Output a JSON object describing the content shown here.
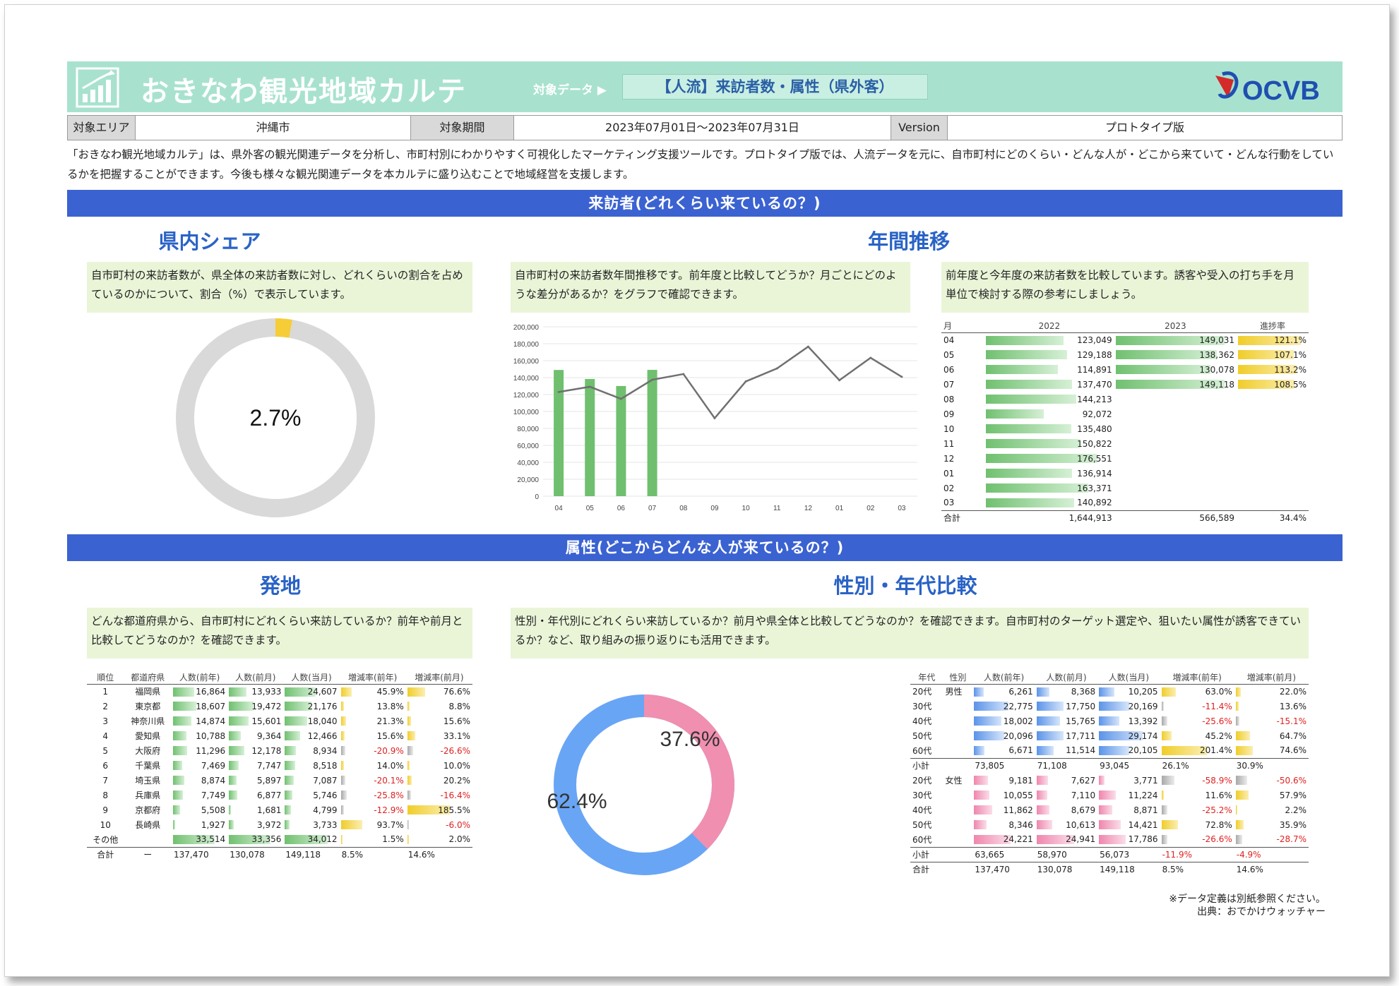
{
  "header": {
    "title": "おきなわ観光地域カルテ",
    "target_label": "対象データ ▶",
    "target_value": "【人流】来訪者数・属性（県外客）",
    "brand": "OCVB"
  },
  "info": {
    "area_label": "対象エリア",
    "area_value": "沖縄市",
    "period_label": "対象期間",
    "period_value": "2023年07月01日～2023年07月31日",
    "version_label": "Version",
    "version_value": "プロトタイプ版"
  },
  "intro": "「おきなわ観光地域カルテ」は、県外客の観光関連データを分析し、市町村別にわかりやすく可視化したマーケティング支援ツールです。プロトタイプ版では、人流データを元に、自市町村にどのくらい・どんな人が・どこから来ていて・どんな行動をしているかを把握することができます。今後も様々な観光関連データを本カルテに盛り込むことで地域経営を支援します。",
  "band1": "来訪者(どれくらい来ているの？)",
  "share": {
    "title": "県内シェア",
    "note": "自市町村の来訪者数が、県全体の来訪者数に対し、どれくらいの割合を占めているのかについて、割合（%）で表示しています。",
    "value_label": "2.7%",
    "value": 2.7,
    "colors": {
      "fill": "#f7cd37",
      "rest": "#d9d9d9"
    }
  },
  "annual": {
    "title": "年間推移",
    "note": "自市町村の来訪者数年間推移です。前年度と比較してどうか？月ごとにどのような差分があるか？をグラフで確認できます。",
    "note2": "前年度と今年度の来訪者数を比較しています。誘客や受入の打ち手を月単位で検討する際の参考にしましょう。"
  },
  "chart_data": {
    "type": "bar",
    "categories": [
      "04",
      "05",
      "06",
      "07",
      "08",
      "09",
      "10",
      "11",
      "12",
      "01",
      "02",
      "03"
    ],
    "series": [
      {
        "type": "bar",
        "values": [
          149031,
          138362,
          130078,
          149118,
          null,
          null,
          null,
          null,
          null,
          null,
          null,
          null
        ],
        "color": "#6fbf6f"
      },
      {
        "type": "line",
        "values": [
          123049,
          129188,
          114891,
          137470,
          144213,
          92072,
          135480,
          150822,
          176551,
          136914,
          163371,
          140892
        ],
        "color": "#707070"
      }
    ],
    "ylim": [
      0,
      200000
    ],
    "yticks": [
      "200,000",
      "180,000",
      "160,000",
      "140,000",
      "120,000",
      "100,000",
      "80,000",
      "60,000",
      "40,000",
      "20,000",
      "0"
    ]
  },
  "monthly_table": {
    "headers": [
      "月",
      "2022",
      "2023",
      "進捗率"
    ],
    "rows": [
      {
        "m": "04",
        "a": "123,049",
        "b": "149,031",
        "r": "121.1%"
      },
      {
        "m": "05",
        "a": "129,188",
        "b": "138,362",
        "r": "107.1%"
      },
      {
        "m": "06",
        "a": "114,891",
        "b": "130,078",
        "r": "113.2%"
      },
      {
        "m": "07",
        "a": "137,470",
        "b": "149,118",
        "r": "108.5%"
      },
      {
        "m": "08",
        "a": "144,213",
        "b": "",
        "r": ""
      },
      {
        "m": "09",
        "a": "92,072",
        "b": "",
        "r": ""
      },
      {
        "m": "10",
        "a": "135,480",
        "b": "",
        "r": ""
      },
      {
        "m": "11",
        "a": "150,822",
        "b": "",
        "r": ""
      },
      {
        "m": "12",
        "a": "176,551",
        "b": "",
        "r": ""
      },
      {
        "m": "01",
        "a": "136,914",
        "b": "",
        "r": ""
      },
      {
        "m": "02",
        "a": "163,371",
        "b": "",
        "r": ""
      },
      {
        "m": "03",
        "a": "140,892",
        "b": "",
        "r": ""
      }
    ],
    "total": {
      "m": "合計",
      "a": "1,644,913",
      "b": "566,589",
      "r": "34.4%"
    }
  },
  "band2": "属性(どこからどんな人が来ているの？)",
  "origin": {
    "title": "発地",
    "note": "どんな都道府県から、自市町村にどれくらい来訪しているか？前年や前月と比較してどうなのか？を確認できます。",
    "headers": [
      "順位",
      "都道府県",
      "人数(前年)",
      "人数(前月)",
      "人数(当月)",
      "増減率(前年)",
      "増減率(前月)"
    ],
    "rows": [
      {
        "rank": "1",
        "pref": "福岡県",
        "p1": "16,864",
        "p2": "13,933",
        "p3": "24,607",
        "r1": "45.9%",
        "r2": "76.6%"
      },
      {
        "rank": "2",
        "pref": "東京都",
        "p1": "18,607",
        "p2": "19,472",
        "p3": "21,176",
        "r1": "13.8%",
        "r2": "8.8%"
      },
      {
        "rank": "3",
        "pref": "神奈川県",
        "p1": "14,874",
        "p2": "15,601",
        "p3": "18,040",
        "r1": "21.3%",
        "r2": "15.6%"
      },
      {
        "rank": "4",
        "pref": "愛知県",
        "p1": "10,788",
        "p2": "9,364",
        "p3": "12,466",
        "r1": "15.6%",
        "r2": "33.1%"
      },
      {
        "rank": "5",
        "pref": "大阪府",
        "p1": "11,296",
        "p2": "12,178",
        "p3": "8,934",
        "r1": "-20.9%",
        "r2": "-26.6%"
      },
      {
        "rank": "6",
        "pref": "千葉県",
        "p1": "7,469",
        "p2": "7,747",
        "p3": "8,518",
        "r1": "14.0%",
        "r2": "10.0%"
      },
      {
        "rank": "7",
        "pref": "埼玉県",
        "p1": "8,874",
        "p2": "5,897",
        "p3": "7,087",
        "r1": "-20.1%",
        "r2": "20.2%"
      },
      {
        "rank": "8",
        "pref": "兵庫県",
        "p1": "7,749",
        "p2": "6,877",
        "p3": "5,746",
        "r1": "-25.8%",
        "r2": "-16.4%"
      },
      {
        "rank": "9",
        "pref": "京都府",
        "p1": "5,508",
        "p2": "1,681",
        "p3": "4,799",
        "r1": "-12.9%",
        "r2": "185.5%"
      },
      {
        "rank": "10",
        "pref": "長崎県",
        "p1": "1,927",
        "p2": "3,972",
        "p3": "3,733",
        "r1": "93.7%",
        "r2": "-6.0%"
      },
      {
        "rank": "その他",
        "pref": "",
        "p1": "33,514",
        "p2": "33,356",
        "p3": "34,012",
        "r1": "1.5%",
        "r2": "2.0%"
      }
    ],
    "total": {
      "rank": "合計",
      "pref": "ー",
      "p1": "137,470",
      "p2": "130,078",
      "p3": "149,118",
      "r1": "8.5%",
      "r2": "14.6%"
    }
  },
  "gender": {
    "title": "性別・年代比較",
    "note": "性別・年代別にどれくらい来訪しているか？前月や県全体と比較してどうなのか？を確認できます。自市町村のターゲット選定や、狙いたい属性が誘客できているか？など、取り組みの振り返りにも活用できます。",
    "donut": {
      "female_label": "37.6%",
      "male_label": "62.4%",
      "female": 37.6,
      "male": 62.4,
      "colors": {
        "female": "#f08fb0",
        "male": "#69a5f5"
      }
    },
    "headers": [
      "年代",
      "性別",
      "人数(前年)",
      "人数(前月)",
      "人数(当月)",
      "増減率(前年)",
      "増減率(前月)"
    ],
    "male_rows": [
      {
        "age": "20代",
        "sex": "男性",
        "p1": "6,261",
        "p2": "8,368",
        "p3": "10,205",
        "r1": "63.0%",
        "r2": "22.0%"
      },
      {
        "age": "30代",
        "sex": "",
        "p1": "22,775",
        "p2": "17,750",
        "p3": "20,169",
        "r1": "-11.4%",
        "r2": "13.6%"
      },
      {
        "age": "40代",
        "sex": "",
        "p1": "18,002",
        "p2": "15,765",
        "p3": "13,392",
        "r1": "-25.6%",
        "r2": "-15.1%"
      },
      {
        "age": "50代",
        "sex": "",
        "p1": "20,096",
        "p2": "17,711",
        "p3": "29,174",
        "r1": "45.2%",
        "r2": "64.7%"
      },
      {
        "age": "60代",
        "sex": "",
        "p1": "6,671",
        "p2": "11,514",
        "p3": "20,105",
        "r1": "201.4%",
        "r2": "74.6%"
      }
    ],
    "male_total": {
      "age": "小計",
      "sex": "",
      "p1": "73,805",
      "p2": "71,108",
      "p3": "93,045",
      "r1": "26.1%",
      "r2": "30.9%"
    },
    "female_rows": [
      {
        "age": "20代",
        "sex": "女性",
        "p1": "9,181",
        "p2": "7,627",
        "p3": "3,771",
        "r1": "-58.9%",
        "r2": "-50.6%"
      },
      {
        "age": "30代",
        "sex": "",
        "p1": "10,055",
        "p2": "7,110",
        "p3": "11,224",
        "r1": "11.6%",
        "r2": "57.9%"
      },
      {
        "age": "40代",
        "sex": "",
        "p1": "11,862",
        "p2": "8,679",
        "p3": "8,871",
        "r1": "-25.2%",
        "r2": "2.2%"
      },
      {
        "age": "50代",
        "sex": "",
        "p1": "8,346",
        "p2": "10,613",
        "p3": "14,421",
        "r1": "72.8%",
        "r2": "35.9%"
      },
      {
        "age": "60代",
        "sex": "",
        "p1": "24,221",
        "p2": "24,941",
        "p3": "17,786",
        "r1": "-26.6%",
        "r2": "-28.7%"
      }
    ],
    "female_total": {
      "age": "小計",
      "sex": "",
      "p1": "63,665",
      "p2": "58,970",
      "p3": "56,073",
      "r1": "-11.9%",
      "r2": "-4.9%"
    },
    "grand_total": {
      "age": "合計",
      "sex": "",
      "p1": "137,470",
      "p2": "130,078",
      "p3": "149,118",
      "r1": "8.5%",
      "r2": "14.6%"
    }
  },
  "footer": {
    "line1": "※データ定義は別紙参照ください。",
    "line2": "出典：おでかけウォッチャー"
  }
}
